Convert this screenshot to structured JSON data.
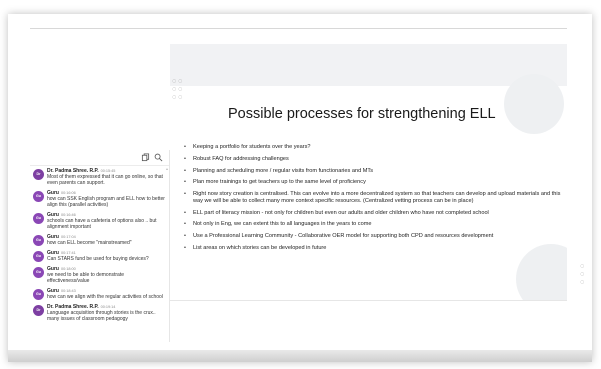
{
  "chat": {
    "messages": [
      {
        "avatar": "Dr",
        "author": "Dr. Padma Shree. R.P.",
        "time": "00:15:45",
        "text": "Most of them expressed that it can go online, so that even parents can support."
      },
      {
        "avatar": "Gu",
        "author": "Guru",
        "time": "00:16:06",
        "text": "how can SSK English program and ELL how to better align this (parallel activities)"
      },
      {
        "avatar": "Gu",
        "author": "Guru",
        "time": "00:16:46",
        "text": "schools can have a cafeteria of options also .. but alignment important"
      },
      {
        "avatar": "Gu",
        "author": "Guru",
        "time": "00:17:04",
        "text": "how can ELL become \"mainstreamed\""
      },
      {
        "avatar": "Gu",
        "author": "Guru",
        "time": "00:17:41",
        "text": "Can STARS fund be used for buying devices?"
      },
      {
        "avatar": "Gu",
        "author": "Guru",
        "time": "00:18:00",
        "text": "we need to be able to demonstrate effectiveness/value"
      },
      {
        "avatar": "Gu",
        "author": "Guru",
        "time": "00:18:43",
        "text": "how can we align with the regular activities of school"
      },
      {
        "avatar": "Dr",
        "author": "Dr. Padma Shree. R.P.",
        "time": "00:19:14",
        "text": "Language acquisition through stories is the crux.. many issues of classroom pedagogy"
      }
    ]
  },
  "slide": {
    "title": "Possible processes for strengthening ELL",
    "bullets": [
      "Keeping a portfolio for students over the years?",
      "Robust FAQ for addressing challenges",
      "Planning and scheduling more / regular visits from functionaries and MTs",
      "Plan more trainings to get teachers up to the same level of proficiency",
      "Right now story creation is centralised. This can evolve into a more decentralized system so that teachers can develop and upload materials and this way we will be able to collect many more context specific resources. (Centralized vetting process can be in place)",
      "ELL part of literacy mission - not only for children but even our adults and older children who have not completed school",
      "Not only in Eng, we can extent this to all languages in the years to come",
      "Use a Professional Learning Community - Collaborative OER model for supporting both CPD and resources development",
      "List areas on which stories can be developed in future"
    ]
  },
  "colors": {
    "avatar_purple": "#7d3fa2",
    "slide_header_bg": "#f1f2f4"
  }
}
